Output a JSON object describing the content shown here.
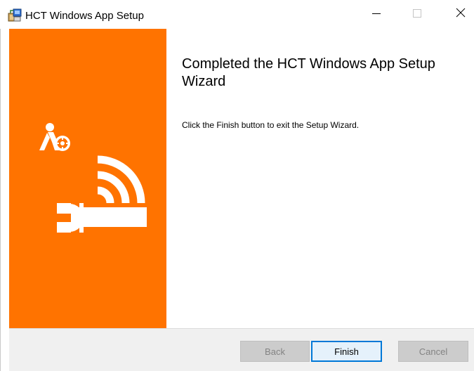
{
  "window": {
    "title": "HCT Windows App Setup",
    "app_icon": "installer-package-icon",
    "controls": {
      "minimize_icon": "minimize-icon",
      "maximize_icon": "maximize-icon",
      "close_icon": "close-icon"
    }
  },
  "banner": {
    "color": "#ff7300",
    "logo_icon": "hct-logo-icon",
    "art_icon": "wrench-wireless-icon"
  },
  "content": {
    "heading": "Completed the HCT Windows App Setup Wizard",
    "body": "Click the Finish button to exit the Setup Wizard."
  },
  "footer": {
    "back_label": "Back",
    "finish_label": "Finish",
    "cancel_label": "Cancel",
    "back_enabled": false,
    "finish_enabled": true,
    "cancel_enabled": false,
    "accent_color": "#0078d7"
  }
}
